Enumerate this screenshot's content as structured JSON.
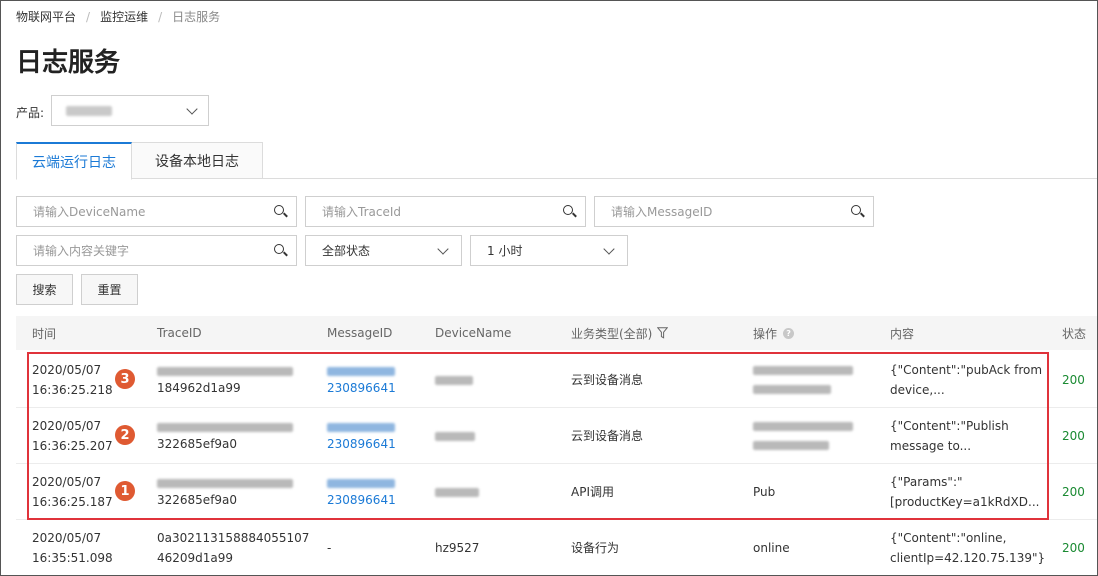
{
  "breadcrumb": [
    "物联网平台",
    "监控运维",
    "日志服务"
  ],
  "page_title": "日志服务",
  "product": {
    "label": "产品:",
    "value_redacted": true
  },
  "tabs": [
    {
      "label": "云端运行日志",
      "active": true
    },
    {
      "label": "设备本地日志",
      "active": false
    }
  ],
  "filters": {
    "device_name_placeholder": "请输入DeviceName",
    "trace_id_placeholder": "请输入TraceId",
    "message_id_placeholder": "请输入MessageID",
    "keyword_placeholder": "请输入内容关键字",
    "status_value": "全部状态",
    "time_range_value": "1 小时",
    "search_label": "搜索",
    "reset_label": "重置"
  },
  "table": {
    "headers": {
      "time": "时间",
      "trace_id": "TraceID",
      "message_id": "MessageID",
      "device_name": "DeviceName",
      "biz_type": "业务类型(全部)",
      "action": "操作",
      "content": "内容",
      "status": "状态"
    },
    "rows": [
      {
        "badge": "3",
        "date": "2020/05/07",
        "time": "16:36:25.218",
        "trace_suffix": "184962d1a99",
        "message_suffix": "230896641",
        "device_name": "",
        "biz_type": "云到设备消息",
        "action": "",
        "content_line1": "{\"Content\":\"pubAck from",
        "content_line2": "device,...",
        "status": "200"
      },
      {
        "badge": "2",
        "date": "2020/05/07",
        "time": "16:36:25.207",
        "trace_suffix": "322685ef9a0",
        "message_suffix": "230896641",
        "device_name": "",
        "biz_type": "云到设备消息",
        "action": "",
        "content_line1": "{\"Content\":\"Publish",
        "content_line2": "message to...",
        "status": "200"
      },
      {
        "badge": "1",
        "date": "2020/05/07",
        "time": "16:36:25.187",
        "trace_suffix": "322685ef9a0",
        "message_suffix": "230896641",
        "device_name": "",
        "biz_type": "API调用",
        "action": "Pub",
        "content_line1": "{\"Params\":\"",
        "content_line2": "[productKey=a1kRdXD...",
        "status": "200"
      },
      {
        "badge": "",
        "date": "2020/05/07",
        "time": "16:35:51.098",
        "trace_line1": "0a302113158884055107",
        "trace_line2": "46209d1a99",
        "message_id": "-",
        "device_name": "hz9527",
        "biz_type": "设备行为",
        "action": "online",
        "content_line1": "{\"Content\":\"online,",
        "content_line2": "clientIp=42.120.75.139\"}",
        "status": "200"
      }
    ]
  },
  "colors": {
    "accent": "#1b7ad6",
    "status_ok": "#1a8a32",
    "badge": "#df5a32",
    "highlight": "#e0333b"
  }
}
